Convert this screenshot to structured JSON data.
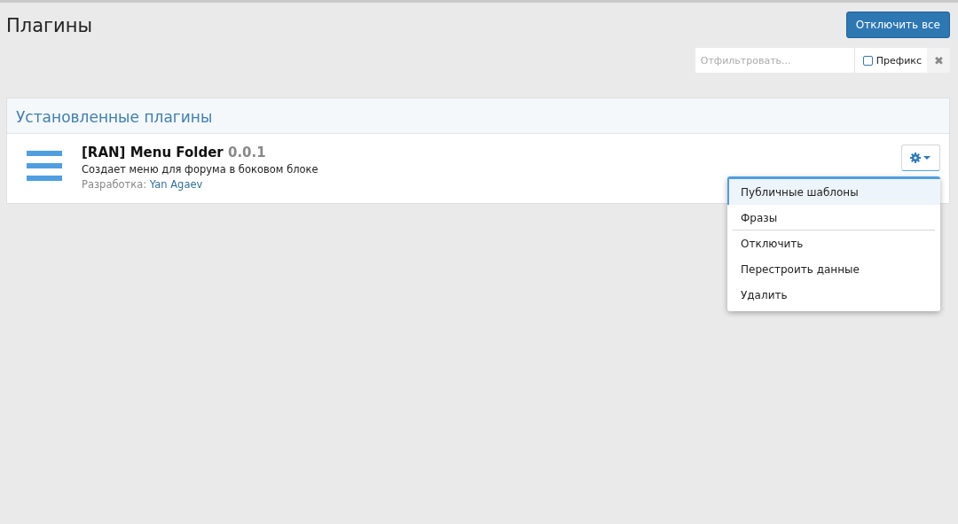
{
  "page_title": "Плагины",
  "disable_all_button": "Отключить все",
  "filter": {
    "placeholder": "Отфильтровать...",
    "prefix_label": "Префикс",
    "prefix_checked": false,
    "clear_icon": "✖"
  },
  "section": {
    "title": "Установленные плагины",
    "plugins": [
      {
        "name": "[RAN] Menu Folder",
        "version": "0.0.1",
        "description": "Создает меню для форума в боковом блоке",
        "developer_label": "Разработка:",
        "developer": "Yan Agaev",
        "menu": {
          "expanded": true,
          "items": [
            {
              "label": "Публичные шаблоны",
              "selected": true,
              "divider_after": false
            },
            {
              "label": "Фразы",
              "selected": false,
              "divider_after": true
            },
            {
              "label": "Отключить",
              "selected": false,
              "divider_after": false
            },
            {
              "label": "Перестроить данные",
              "selected": false,
              "divider_after": false
            },
            {
              "label": "Удалить",
              "selected": false,
              "divider_after": false
            }
          ]
        }
      }
    ]
  }
}
